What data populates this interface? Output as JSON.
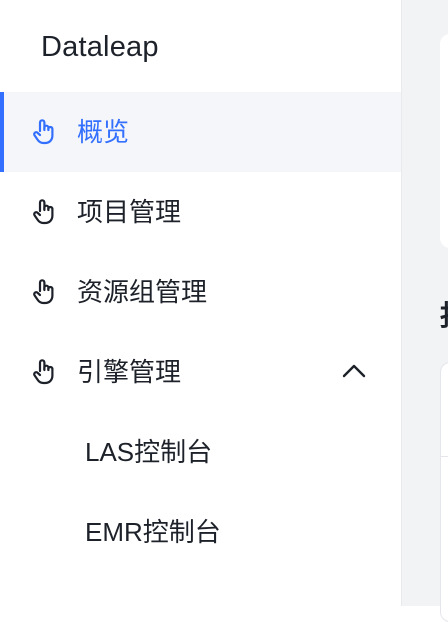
{
  "app": {
    "brand": "Dataleap"
  },
  "sidebar": {
    "items": [
      {
        "label": "概览",
        "icon": "hand-pointer-icon",
        "active": true
      },
      {
        "label": "项目管理",
        "icon": "hand-pointer-icon",
        "active": false
      },
      {
        "label": "资源组管理",
        "icon": "hand-pointer-icon",
        "active": false
      },
      {
        "label": "引擎管理",
        "icon": "hand-pointer-icon",
        "active": false,
        "expanded": true,
        "children": [
          {
            "label": "LAS控制台"
          },
          {
            "label": "EMR控制台"
          }
        ]
      }
    ]
  },
  "main": {
    "section_glyph": "报"
  },
  "colors": {
    "accent": "#3370ff",
    "text": "#1d2129",
    "active_bg": "#f4f6f9",
    "page_bg": "#f2f3f5"
  }
}
